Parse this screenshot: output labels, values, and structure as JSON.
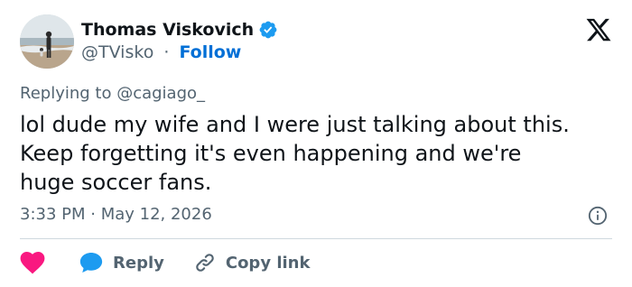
{
  "author": {
    "display_name": "Thomas Viskovich",
    "handle": "@TVisko",
    "separator": "·",
    "follow_label": "Follow"
  },
  "replying_to": "Replying to @cagiago_",
  "tweet": {
    "lines": [
      "lol dude my wife and I were just talking about this.",
      "Keep forgetting it's even happening and we're",
      "huge soccer fans."
    ]
  },
  "timestamp": "3:33 PM · May 12, 2026",
  "actions": {
    "reply_label": "Reply",
    "copy_link_label": "Copy link"
  },
  "colors": {
    "like": "#f91880",
    "reply": "#1d9bf0",
    "follow": "#006fd6",
    "verified": "#1d9bf0",
    "secondary_text": "#536471",
    "primary_text": "#0f1419",
    "divider": "#cfd9de"
  },
  "icons": {
    "brand": "x-logo-icon",
    "verified": "verified-badge-icon",
    "info": "info-icon",
    "like": "heart-icon",
    "reply": "speech-bubble-icon",
    "copy_link": "chain-link-icon"
  }
}
